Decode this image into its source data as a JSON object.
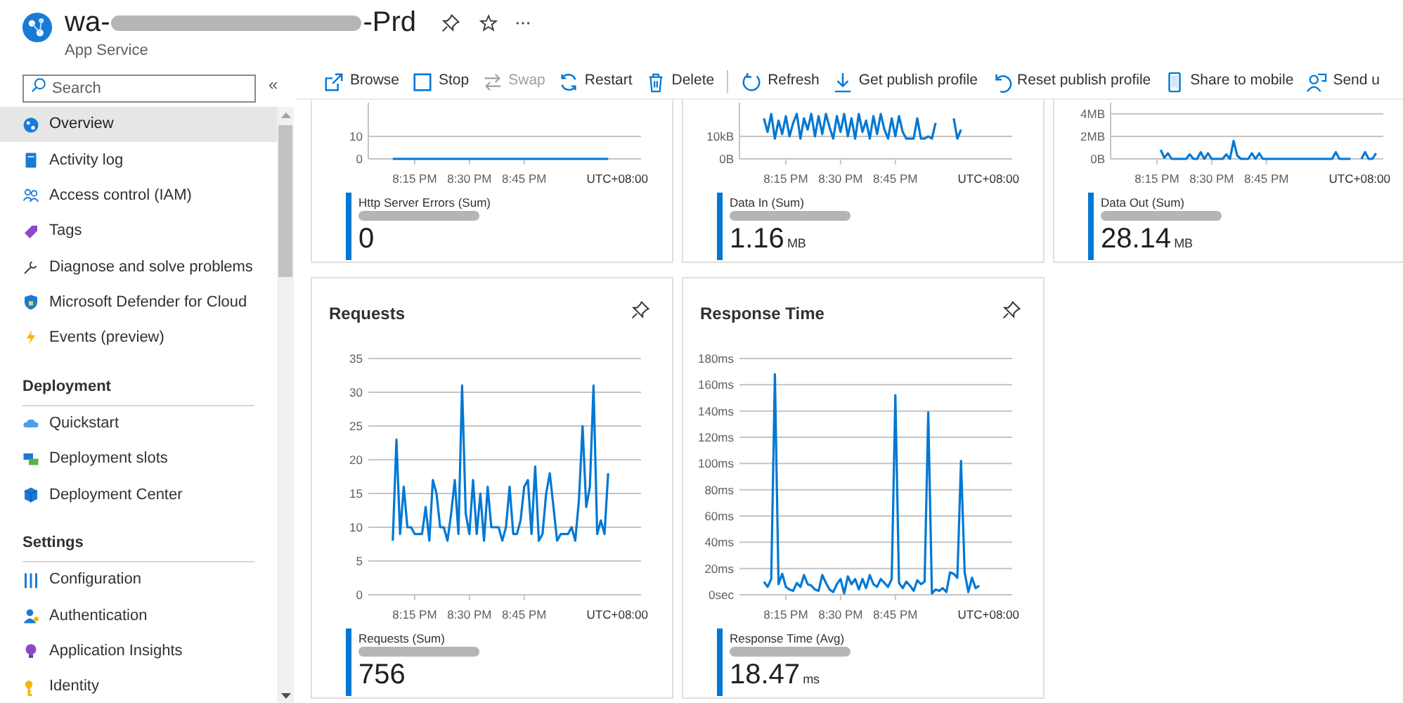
{
  "header": {
    "title_start": "wa-",
    "title_end": "-Prd",
    "subtitle": "App Service"
  },
  "sidebar": {
    "search": {
      "placeholder": "Search"
    },
    "collapse": "«",
    "sections": [
      {
        "items": [
          {
            "label": "Overview",
            "selected": true
          },
          {
            "label": "Activity log",
            "selected": false
          },
          {
            "label": "Access control (IAM)",
            "selected": false
          },
          {
            "label": "Tags",
            "selected": false
          },
          {
            "label": "Diagnose and solve problems",
            "selected": false
          },
          {
            "label": "Microsoft Defender for Cloud",
            "selected": false
          },
          {
            "label": "Events (preview)",
            "selected": false
          }
        ]
      },
      {
        "heading": "Deployment",
        "items": [
          {
            "label": "Quickstart",
            "selected": false
          },
          {
            "label": "Deployment slots",
            "selected": false
          },
          {
            "label": "Deployment Center",
            "selected": false
          }
        ]
      },
      {
        "heading": "Settings",
        "items": [
          {
            "label": "Configuration",
            "selected": false
          },
          {
            "label": "Authentication",
            "selected": false
          },
          {
            "label": "Application Insights",
            "selected": false
          },
          {
            "label": "Identity",
            "selected": false
          }
        ]
      }
    ]
  },
  "toolbar": [
    {
      "label": "Browse",
      "disabled": false
    },
    {
      "label": "Stop",
      "disabled": false
    },
    {
      "label": "Swap",
      "disabled": true
    },
    {
      "label": "Restart",
      "disabled": false
    },
    {
      "label": "Delete",
      "disabled": false
    },
    {
      "label": "Refresh",
      "disabled": false
    },
    {
      "label": "Get publish profile",
      "disabled": false
    },
    {
      "label": "Reset publish profile",
      "disabled": false
    },
    {
      "label": "Share to mobile",
      "disabled": false
    },
    {
      "label": "Send u",
      "disabled": false
    }
  ],
  "metric_rows": [
    {
      "cards": [
        {
          "legend": {
            "value": "0"
          },
          "timezone": "UTC+08:00",
          "chart_data": {
            "type": "line",
            "grid": true,
            "ylim": [
              0,
              25
            ],
            "yticks": [
              0,
              10
            ],
            "categories": [
              null,
              null,
              null,
              null,
              null,
              null,
              null,
              null,
              null,
              null,
              null,
              null,
              null,
              null,
              null,
              "8:15 PM",
              null,
              null,
              null,
              null,
              null,
              null,
              null,
              null,
              null,
              null,
              null,
              null,
              null,
              null,
              "8:30 PM",
              null,
              null,
              null,
              null,
              null,
              null,
              null,
              null,
              null,
              null,
              null,
              null,
              null,
              null,
              "8:45 PM",
              null,
              null,
              null,
              null,
              null,
              null,
              null,
              null,
              null,
              null,
              null,
              null,
              null,
              null,
              null,
              null,
              null,
              null,
              null,
              null,
              null,
              null,
              null,
              null,
              null,
              null,
              null,
              null,
              null,
              null,
              null,
              null
            ],
            "series": [
              {
                "name": "Http Server Errors (Sum)",
                "color": "#0078d4",
                "values": [
                  null,
                  null,
                  null,
                  null,
                  null,
                  null,
                  null,
                  null,
                  null,
                  0,
                  0,
                  0,
                  0,
                  0,
                  0,
                  0,
                  0,
                  0,
                  0,
                  0,
                  0,
                  0,
                  0,
                  0,
                  0,
                  0,
                  0,
                  0,
                  0,
                  0,
                  0,
                  0,
                  0,
                  0,
                  0,
                  0,
                  0,
                  0,
                  0,
                  0,
                  0,
                  0,
                  0,
                  0,
                  0,
                  0,
                  0,
                  0,
                  0,
                  0,
                  0,
                  0,
                  0,
                  0,
                  0,
                  0,
                  0,
                  0,
                  0,
                  0,
                  0,
                  0,
                  0,
                  0,
                  0,
                  0,
                  0,
                  0,
                  0,
                  null,
                  null,
                  null,
                  null,
                  null,
                  null,
                  null,
                  null,
                  null
                ]
              }
            ]
          }
        },
        {
          "legend": {
            "value": "1.16",
            "unit": "MB"
          },
          "timezone": "UTC+08:00",
          "chart_data": {
            "type": "line",
            "grid": true,
            "ylim": [
              0,
              25
            ],
            "yticks": [
              {
                "value": 0,
                "label": "0B"
              },
              {
                "value": 10,
                "label": "10kB"
              }
            ],
            "categories": [
              null,
              null,
              null,
              null,
              null,
              null,
              null,
              null,
              null,
              null,
              null,
              null,
              null,
              null,
              null,
              "8:15 PM",
              null,
              null,
              null,
              null,
              null,
              null,
              null,
              null,
              null,
              null,
              null,
              null,
              null,
              null,
              "8:30 PM",
              null,
              null,
              null,
              null,
              null,
              null,
              null,
              null,
              null,
              null,
              null,
              null,
              null,
              null,
              "8:45 PM",
              null,
              null,
              null,
              null,
              null,
              null,
              null,
              null,
              null,
              null,
              null,
              null,
              null,
              null,
              null,
              null,
              null,
              null,
              null,
              null,
              null,
              null,
              null,
              null,
              null,
              null,
              null,
              null,
              null,
              null,
              null,
              null
            ],
            "series": [
              {
                "name": "Data In (Sum)",
                "color": "#0078d4",
                "values": [
                  null,
                  null,
                  null,
                  null,
                  null,
                  null,
                  null,
                  null,
                  null,
                  18,
                  12,
                  20,
                  9,
                  17,
                  11,
                  19,
                  10,
                  16,
                  20,
                  9,
                  18,
                  13,
                  20,
                  10,
                  19,
                  11,
                  20,
                  14,
                  9,
                  19,
                  12,
                  20,
                  10,
                  18,
                  9,
                  20,
                  12,
                  17,
                  9,
                  19,
                  11,
                  20,
                  13,
                  9,
                  18,
                  10,
                  19,
                  12,
                  9,
                  9,
                  9,
                  18,
                  9,
                  9,
                  10,
                  9,
                  16,
                  null,
                  null,
                  null,
                  null,
                  18,
                  9,
                  13,
                  null,
                  null,
                  null,
                  null,
                  null,
                  null,
                  null,
                  null,
                  null,
                  null,
                  null,
                  null,
                  null,
                  null
                ]
              }
            ]
          }
        },
        {
          "legend": {
            "value": "28.14",
            "unit": "MB"
          },
          "timezone": "UTC+08:00",
          "chart_data": {
            "type": "line",
            "grid": true,
            "ylim": [
              0,
              5
            ],
            "yticks": [
              {
                "value": 0,
                "label": "0B"
              },
              {
                "value": 2,
                "label": "2MB"
              },
              {
                "value": 4,
                "label": "4MB"
              }
            ],
            "categories": [
              null,
              null,
              null,
              null,
              null,
              null,
              null,
              null,
              null,
              null,
              null,
              null,
              null,
              null,
              null,
              "8:15 PM",
              null,
              null,
              null,
              null,
              null,
              null,
              null,
              null,
              null,
              null,
              null,
              null,
              null,
              null,
              "8:30 PM",
              null,
              null,
              null,
              null,
              null,
              null,
              null,
              null,
              null,
              null,
              null,
              null,
              null,
              null,
              "8:45 PM",
              null,
              null,
              null,
              null,
              null,
              null,
              null,
              null,
              null,
              null,
              null,
              null,
              null,
              null,
              null,
              null,
              null,
              null,
              null,
              null,
              null,
              null,
              null,
              null,
              null,
              null,
              null,
              null,
              null,
              null,
              null,
              null
            ],
            "series": [
              {
                "name": "Data Out (Sum)",
                "color": "#0078d4",
                "values": [
                  null,
                  null,
                  null,
                  null,
                  null,
                  null,
                  null,
                  null,
                  null,
                  null,
                  null,
                  null,
                  null,
                  null,
                  null,
                  null,
                  0.8,
                  0.1,
                  0.5,
                  0,
                  0,
                  0,
                  0,
                  0,
                  0.4,
                  0,
                  0,
                  0.6,
                  0,
                  0.5,
                  0,
                  0,
                  0,
                  0,
                  0.4,
                  0,
                  1.6,
                  0.3,
                  0,
                  0,
                  0,
                  0.5,
                  0,
                  0.5,
                  0,
                  0,
                  0,
                  0,
                  0,
                  0,
                  0,
                  0,
                  0,
                  0,
                  0,
                  0,
                  0,
                  0,
                  0,
                  0,
                  0,
                  0,
                  0,
                  0,
                  0.6,
                  0,
                  0,
                  0,
                  0,
                  null,
                  null,
                  0,
                  0.6,
                  0,
                  0,
                  0.5,
                  null,
                  null
                ]
              }
            ]
          }
        }
      ]
    },
    {
      "cards": [
        {
          "title": "Requests",
          "legend": {
            "value": "756"
          },
          "timezone": "UTC+08:00",
          "chart_data": {
            "type": "line",
            "grid": true,
            "ylim": [
              0,
              35
            ],
            "yticks": [
              0,
              5,
              10,
              15,
              20,
              25,
              30,
              35
            ],
            "categories": [
              null,
              null,
              null,
              null,
              null,
              null,
              null,
              null,
              null,
              null,
              null,
              null,
              null,
              null,
              null,
              "8:15 PM",
              null,
              null,
              null,
              null,
              null,
              null,
              null,
              null,
              null,
              null,
              null,
              null,
              null,
              null,
              "8:30 PM",
              null,
              null,
              null,
              null,
              null,
              null,
              null,
              null,
              null,
              null,
              null,
              null,
              null,
              null,
              "8:45 PM",
              null,
              null,
              null,
              null,
              null,
              null,
              null,
              null,
              null,
              null,
              null,
              null,
              null,
              null,
              null,
              null,
              null,
              null,
              null,
              null,
              null,
              null,
              null,
              null,
              null,
              null,
              null,
              null,
              null,
              null,
              null,
              null
            ],
            "series": [
              {
                "name": "Requests (Sum)",
                "color": "#0078d4",
                "values": [
                  null,
                  null,
                  null,
                  null,
                  null,
                  null,
                  null,
                  null,
                  null,
                  8,
                  23,
                  9,
                  16,
                  10,
                  10,
                  9,
                  9,
                  9,
                  13,
                  8,
                  17,
                  15,
                  10,
                  10,
                  8,
                  12,
                  17,
                  9,
                  31,
                  12,
                  9,
                  17,
                  9,
                  15,
                  8,
                  16,
                  10,
                  10,
                  10,
                  8,
                  10,
                  16,
                  9,
                  9,
                  11,
                  16,
                  17,
                  9,
                  19,
                  8,
                  9,
                  15,
                  18,
                  13,
                  8,
                  9,
                  9,
                  9,
                  10,
                  8,
                  14,
                  25,
                  13,
                  16,
                  31,
                  9,
                  11,
                  9,
                  18,
                  null,
                  null,
                  null,
                  null,
                  null,
                  null,
                  null,
                  null,
                  null
                ]
              }
            ]
          }
        },
        {
          "title": "Response Time",
          "legend": {
            "value": "18.47",
            "unit": "ms"
          },
          "timezone": "UTC+08:00",
          "chart_data": {
            "type": "line",
            "grid": true,
            "ylim": [
              0,
              180
            ],
            "yticks": [
              {
                "value": 0,
                "label": "0sec"
              },
              {
                "value": 20,
                "label": "20ms"
              },
              {
                "value": 40,
                "label": "40ms"
              },
              {
                "value": 60,
                "label": "60ms"
              },
              {
                "value": 80,
                "label": "80ms"
              },
              {
                "value": 100,
                "label": "100ms"
              },
              {
                "value": 120,
                "label": "120ms"
              },
              {
                "value": 140,
                "label": "140ms"
              },
              {
                "value": 160,
                "label": "160ms"
              },
              {
                "value": 180,
                "label": "180ms"
              }
            ],
            "categories": [
              null,
              null,
              null,
              null,
              null,
              null,
              null,
              null,
              null,
              null,
              null,
              null,
              null,
              null,
              null,
              "8:15 PM",
              null,
              null,
              null,
              null,
              null,
              null,
              null,
              null,
              null,
              null,
              null,
              null,
              null,
              null,
              "8:30 PM",
              null,
              null,
              null,
              null,
              null,
              null,
              null,
              null,
              null,
              null,
              null,
              null,
              null,
              null,
              "8:45 PM",
              null,
              null,
              null,
              null,
              null,
              null,
              null,
              null,
              null,
              null,
              null,
              null,
              null,
              null,
              null,
              null,
              null,
              null,
              null,
              null,
              null,
              null,
              null,
              null,
              null,
              null,
              null,
              null,
              null,
              null,
              null,
              null
            ],
            "series": [
              {
                "name": "Response Time (Avg)",
                "color": "#0078d4",
                "values": [
                  null,
                  null,
                  null,
                  null,
                  null,
                  null,
                  null,
                  null,
                  null,
                  10,
                  6,
                  12,
                  168,
                  8,
                  16,
                  6,
                  4,
                  3,
                  9,
                  6,
                  15,
                  8,
                  7,
                  4,
                  3,
                  15,
                  9,
                  4,
                  2,
                  8,
                  12,
                  1,
                  14,
                  8,
                  12,
                  4,
                  12,
                  5,
                  15,
                  8,
                  6,
                  12,
                  9,
                  6,
                  12,
                  152,
                  9,
                  5,
                  10,
                  7,
                  3,
                  11,
                  8,
                  10,
                  139,
                  1,
                  4,
                  3,
                  5,
                  2,
                  17,
                  16,
                  13,
                  102,
                  17,
                  2,
                  13,
                  5,
                  7,
                  null,
                  null,
                  null,
                  null,
                  null,
                  null,
                  null,
                  null,
                  null
                ]
              }
            ]
          }
        }
      ]
    }
  ]
}
